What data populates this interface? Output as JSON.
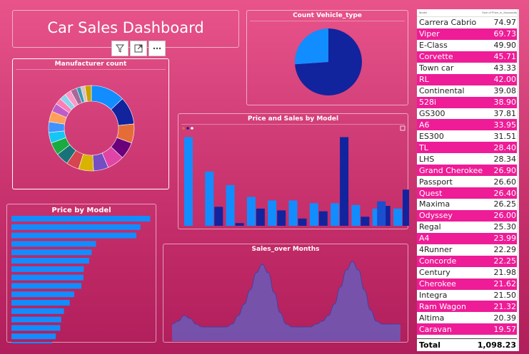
{
  "dashboard": {
    "title": "Car Sales Dashboard",
    "panels": {
      "manufacturer": "Manufacturer count",
      "vehicle_type": "Count Vehicle_type",
      "price_sales": "Price and Sales by Model",
      "price_by_model": "Price by Model",
      "sales_over_months": "Sales_over Months"
    },
    "toolbar": [
      {
        "name": "filter-icon",
        "glyph": "⊽"
      },
      {
        "name": "focus-mode-icon",
        "glyph": "⤢"
      },
      {
        "name": "more-options-icon",
        "glyph": "⋯"
      }
    ]
  },
  "colors": {
    "primary": "#118dff",
    "secondary": "#12239e",
    "highlight": "#ee1c96",
    "area": "#6b5bb8"
  },
  "chart_data": [
    {
      "type": "pie",
      "id": "manufacturer",
      "title": "Manufacturer count",
      "donut": true,
      "values": [
        16,
        13,
        9,
        8,
        8,
        7,
        7,
        6,
        6,
        6,
        5,
        5,
        5,
        4,
        3,
        3,
        3,
        3,
        2,
        2,
        3
      ],
      "colors": [
        "#118dff",
        "#12239e",
        "#e66c37",
        "#6b007b",
        "#e044a7",
        "#744ec2",
        "#d9b300",
        "#d64550",
        "#197278",
        "#1aab40",
        "#15c6f4",
        "#4092ff",
        "#ffa058",
        "#be5dc9",
        "#fd7eb5",
        "#8ad4eb",
        "#fe96c7",
        "#a66999",
        "#3599b8",
        "#dfbfbf",
        "#c9a300"
      ]
    },
    {
      "type": "pie",
      "id": "vehicle_type",
      "title": "Count Vehicle_type",
      "values": [
        116,
        41
      ],
      "colors": [
        "#12239e",
        "#118dff"
      ]
    },
    {
      "type": "bar",
      "id": "price_sales",
      "title": "Price and Sales by Model",
      "series": [
        {
          "values": [
            0.98,
            0.6,
            0.45,
            0.32,
            0.28,
            0.28,
            0.25,
            0.25,
            0.23,
            0.19,
            0.19
          ]
        },
        {
          "values": [
            0.0,
            0.21,
            0.03,
            0.19,
            0.17,
            0.08,
            0.16,
            0.98,
            0.1,
            0.22,
            0.4
          ]
        },
        {
          "values": [
            0.0,
            0.0,
            0.0,
            0.0,
            0.0,
            0.0,
            0.0,
            0.0,
            0.0,
            0.27,
            0.0
          ]
        }
      ]
    },
    {
      "type": "bar",
      "id": "price_by_model",
      "title": "Price by Model",
      "orientation": "horizontal",
      "values": [
        74.97,
        69.73,
        67.5,
        45.71,
        43.33,
        42.0,
        39.08,
        38.9,
        37.81,
        33.95,
        31.51,
        28.4,
        26.9,
        26.4,
        24.0,
        22.0
      ],
      "xlim": [
        0,
        76
      ]
    },
    {
      "type": "area",
      "id": "sales_over_months",
      "title": "Sales_over Months",
      "values": [
        6,
        7,
        9,
        8,
        6,
        5,
        5,
        5,
        5,
        5,
        6,
        9,
        13,
        18,
        24,
        27,
        24,
        17,
        10,
        6,
        5,
        5,
        5,
        5,
        6,
        7,
        9,
        13,
        19,
        25,
        28,
        25,
        18,
        11,
        7,
        6,
        6,
        6,
        6
      ],
      "ylim": [
        0,
        30
      ]
    }
  ],
  "table": {
    "headers": [
      "Model",
      "Sum of Price_in_thousands"
    ],
    "rows": [
      {
        "model": "Carrera Cabrio",
        "value": "74.97",
        "hl": false
      },
      {
        "model": "Viper",
        "value": "69.73",
        "hl": true
      },
      {
        "model": "E-Class",
        "value": "49.90",
        "hl": false
      },
      {
        "model": "Corvette",
        "value": "45.71",
        "hl": true
      },
      {
        "model": "Town car",
        "value": "43.33",
        "hl": false
      },
      {
        "model": "RL",
        "value": "42.00",
        "hl": true
      },
      {
        "model": "Continental",
        "value": "39.08",
        "hl": false
      },
      {
        "model": "528i",
        "value": "38.90",
        "hl": true
      },
      {
        "model": "GS300",
        "value": "37.81",
        "hl": false
      },
      {
        "model": "A6",
        "value": "33.95",
        "hl": true
      },
      {
        "model": "ES300",
        "value": "31.51",
        "hl": false
      },
      {
        "model": "TL",
        "value": "28.40",
        "hl": true
      },
      {
        "model": "LHS",
        "value": "28.34",
        "hl": false
      },
      {
        "model": "Grand Cherokee",
        "value": "26.90",
        "hl": true
      },
      {
        "model": "Passport",
        "value": "26.60",
        "hl": false
      },
      {
        "model": "Quest",
        "value": "26.40",
        "hl": true
      },
      {
        "model": "Maxima",
        "value": "26.25",
        "hl": false
      },
      {
        "model": "Odyssey",
        "value": "26.00",
        "hl": true
      },
      {
        "model": "Regal",
        "value": "25.30",
        "hl": false
      },
      {
        "model": "A4",
        "value": "23.99",
        "hl": true
      },
      {
        "model": "4Runner",
        "value": "22.29",
        "hl": false
      },
      {
        "model": "Concorde",
        "value": "22.25",
        "hl": true
      },
      {
        "model": "Century",
        "value": "21.98",
        "hl": false
      },
      {
        "model": "Cherokee",
        "value": "21.62",
        "hl": true
      },
      {
        "model": "Integra",
        "value": "21.50",
        "hl": false
      },
      {
        "model": "Ram Wagon",
        "value": "21.32",
        "hl": true
      },
      {
        "model": "Altima",
        "value": "20.39",
        "hl": false
      },
      {
        "model": "Caravan",
        "value": "19.57",
        "hl": true
      }
    ],
    "total_label": "Total",
    "total_value": "1,098.23"
  }
}
